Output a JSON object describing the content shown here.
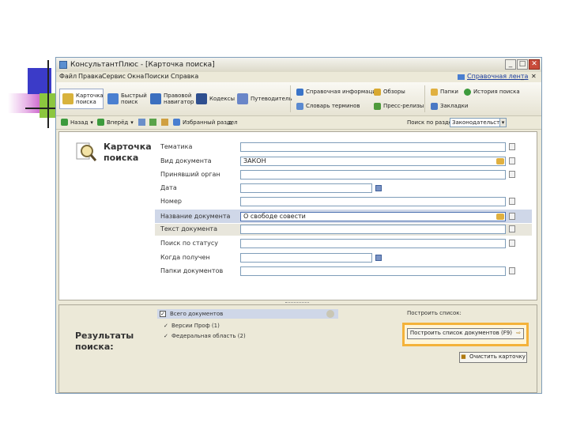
{
  "window": {
    "title": "КонсультантПлюс - [Карточка поиска]",
    "min": "_",
    "max": "□",
    "close": "✕"
  },
  "menu": {
    "items": [
      "Файл",
      "Правка",
      "Сервис",
      "Окна",
      "Поиски",
      "Справка"
    ],
    "help_link": "Справочная лента",
    "extra_min": "_",
    "extra_close": "✕"
  },
  "toolbar": {
    "big": [
      {
        "label": "Карточка поиска",
        "color": "#d8b23c"
      },
      {
        "label": "Быстрый поиск",
        "color": "#4a7fd0"
      },
      {
        "label": "Правовой навигатор",
        "color": "#3b6fbf"
      },
      {
        "label": "Кодексы",
        "color": "#2f4f8f"
      },
      {
        "label": "Путеводитель",
        "color": "#6a86c8"
      }
    ],
    "small": [
      {
        "label": "Справочная информация",
        "color": "#3a74c8"
      },
      {
        "label": "Обзоры",
        "color": "#d8a830"
      },
      {
        "label": "Словарь терминов",
        "color": "#5b8ad0"
      },
      {
        "label": "Пресс-релизы",
        "color": "#4f9a3c"
      },
      {
        "label": "Папки",
        "color": "#e0b040"
      },
      {
        "label": "История поиска",
        "color": "#3d9b3d"
      },
      {
        "label": "Закладки",
        "color": "#4a78c4"
      }
    ]
  },
  "navbar": {
    "items": [
      "Назад",
      "Вперёд",
      "Избранный раздел"
    ],
    "search_label": "Поиск по разделу",
    "search_value": "Законодательство",
    "font_marker": "A"
  },
  "card": {
    "title": "Карточка поиска",
    "fields": [
      {
        "label": "Тематика",
        "value": ""
      },
      {
        "label": "Вид документа",
        "value": "ЗАКОН"
      },
      {
        "label": "Принявший орган",
        "value": ""
      },
      {
        "label": "Дата",
        "value": ""
      },
      {
        "label": "Номер",
        "value": ""
      },
      {
        "label": "Название документа",
        "value": "О свободе совести"
      },
      {
        "label": "Текст документа",
        "value": ""
      },
      {
        "label": "Поиск по статусу",
        "value": ""
      },
      {
        "label": "Когда получен",
        "value": ""
      },
      {
        "label": "Папки документов",
        "value": ""
      }
    ]
  },
  "results": {
    "title": "Результаты поиска:",
    "all_label": "Всего документов",
    "lines": [
      "Версии Проф (1)",
      "Федеральная область (2)"
    ],
    "build_label": "Построить список:",
    "build_button": "Построить список документов (F9)",
    "clear_button": "Очистить карточку"
  }
}
